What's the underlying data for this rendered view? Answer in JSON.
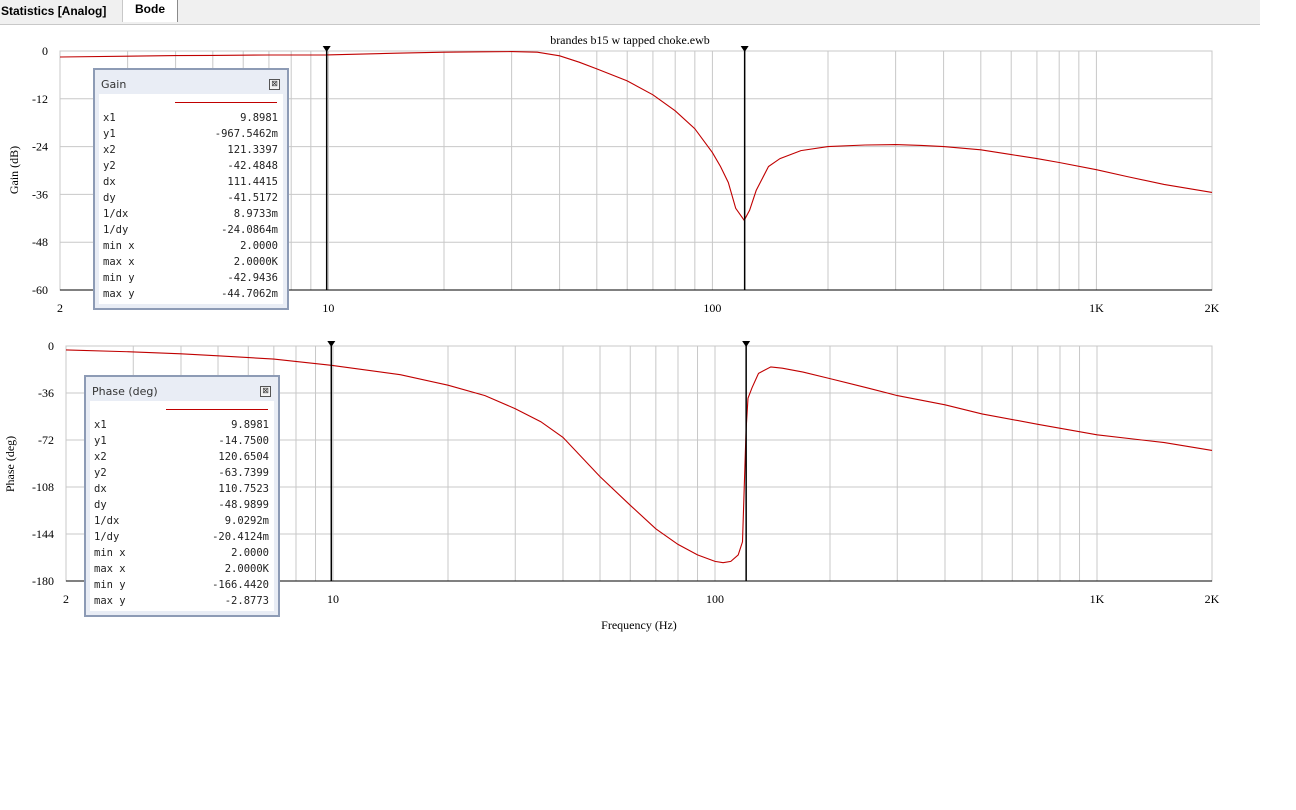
{
  "tabs": [
    {
      "label": "Statistics [Analog]"
    },
    {
      "label": "Bode"
    }
  ],
  "chart_data": [
    {
      "type": "line",
      "title": "brandes b15 w tapped choke.ewb",
      "ylabel": "Gain (dB)",
      "xlabel": "",
      "xscale": "log",
      "xlim": [
        2,
        2000
      ],
      "ylim": [
        -60,
        0
      ],
      "y_ticks": [
        "0",
        "-12",
        "-24",
        "-36",
        "-48",
        "-60"
      ],
      "x_ticks": [
        "2",
        "10",
        "100",
        "1K",
        "2K"
      ],
      "grid": true,
      "series": [
        {
          "color": "#c00000",
          "x": [
            2,
            3,
            4,
            5,
            7,
            9.9,
            15,
            20,
            25,
            30,
            35,
            40,
            45,
            50,
            60,
            70,
            80,
            90,
            100,
            105,
            110,
            115,
            121,
            125,
            130,
            140,
            150,
            170,
            200,
            250,
            300,
            350,
            400,
            500,
            600,
            700,
            800,
            1000,
            1200,
            1500,
            2000
          ],
          "y": [
            -1.5,
            -1.3,
            -1.15,
            -1.1,
            -1.0,
            -0.97,
            -0.55,
            -0.3,
            -0.2,
            -0.15,
            -0.3,
            -1.2,
            -2.8,
            -4.5,
            -7.5,
            -11,
            -15,
            -19.5,
            -25.5,
            -29,
            -33,
            -39.5,
            -42.5,
            -40,
            -35,
            -29,
            -27,
            -25,
            -24,
            -23.6,
            -23.5,
            -23.7,
            -24,
            -24.8,
            -26,
            -27,
            -28,
            -29.8,
            -31.5,
            -33.5,
            -35.5
          ]
        }
      ],
      "cursors": [
        9.8981,
        121.3397
      ],
      "readout": {
        "title": "Gain",
        "rows": [
          {
            "label": "x1",
            "value": "9.8981"
          },
          {
            "label": "y1",
            "value": "-967.5462m"
          },
          {
            "label": "x2",
            "value": "121.3397"
          },
          {
            "label": "y2",
            "value": "-42.4848"
          },
          {
            "label": "dx",
            "value": "111.4415"
          },
          {
            "label": "dy",
            "value": "-41.5172"
          },
          {
            "label": "1/dx",
            "value": "8.9733m"
          },
          {
            "label": "1/dy",
            "value": "-24.0864m"
          },
          {
            "label": "min x",
            "value": "2.0000"
          },
          {
            "label": "max x",
            "value": "2.0000K"
          },
          {
            "label": "min y",
            "value": "-42.9436"
          },
          {
            "label": "max y",
            "value": "-44.7062m"
          }
        ]
      }
    },
    {
      "type": "line",
      "title": "",
      "ylabel": "Phase (deg)",
      "xlabel": "Frequency (Hz)",
      "xscale": "log",
      "xlim": [
        2,
        2000
      ],
      "ylim": [
        -180,
        0
      ],
      "y_ticks": [
        "0",
        "-36",
        "-72",
        "-108",
        "-144",
        "-180"
      ],
      "x_ticks": [
        "2",
        "10",
        "100",
        "1K",
        "2K"
      ],
      "grid": true,
      "series": [
        {
          "color": "#c00000",
          "x": [
            2,
            3,
            4,
            5,
            7,
            9.9,
            15,
            20,
            25,
            30,
            35,
            40,
            50,
            60,
            70,
            80,
            90,
            100,
            105,
            110,
            115,
            118,
            120.65,
            122,
            125,
            130,
            140,
            150,
            170,
            200,
            250,
            300,
            400,
            500,
            700,
            1000,
            1500,
            2000
          ],
          "y": [
            -3,
            -4.5,
            -6,
            -7.5,
            -10,
            -14.75,
            -22,
            -30,
            -38,
            -48,
            -58,
            -70,
            -100,
            -122,
            -140,
            -152,
            -160,
            -165,
            -166,
            -165,
            -160,
            -150,
            -63.74,
            -40,
            -32,
            -21,
            -16,
            -17,
            -20,
            -25,
            -32,
            -38,
            -45,
            -52,
            -60,
            -68,
            -74,
            -80
          ]
        }
      ],
      "cursors": [
        9.8981,
        120.6504
      ],
      "readout": {
        "title": "Phase (deg)",
        "rows": [
          {
            "label": "x1",
            "value": "9.8981"
          },
          {
            "label": "y1",
            "value": "-14.7500"
          },
          {
            "label": "x2",
            "value": "120.6504"
          },
          {
            "label": "y2",
            "value": "-63.7399"
          },
          {
            "label": "dx",
            "value": "110.7523"
          },
          {
            "label": "dy",
            "value": "-48.9899"
          },
          {
            "label": "1/dx",
            "value": "9.0292m"
          },
          {
            "label": "1/dy",
            "value": "-20.4124m"
          },
          {
            "label": "min x",
            "value": "2.0000"
          },
          {
            "label": "max x",
            "value": "2.0000K"
          },
          {
            "label": "min y",
            "value": "-166.4420"
          },
          {
            "label": "max y",
            "value": "-2.8773"
          }
        ]
      }
    }
  ]
}
